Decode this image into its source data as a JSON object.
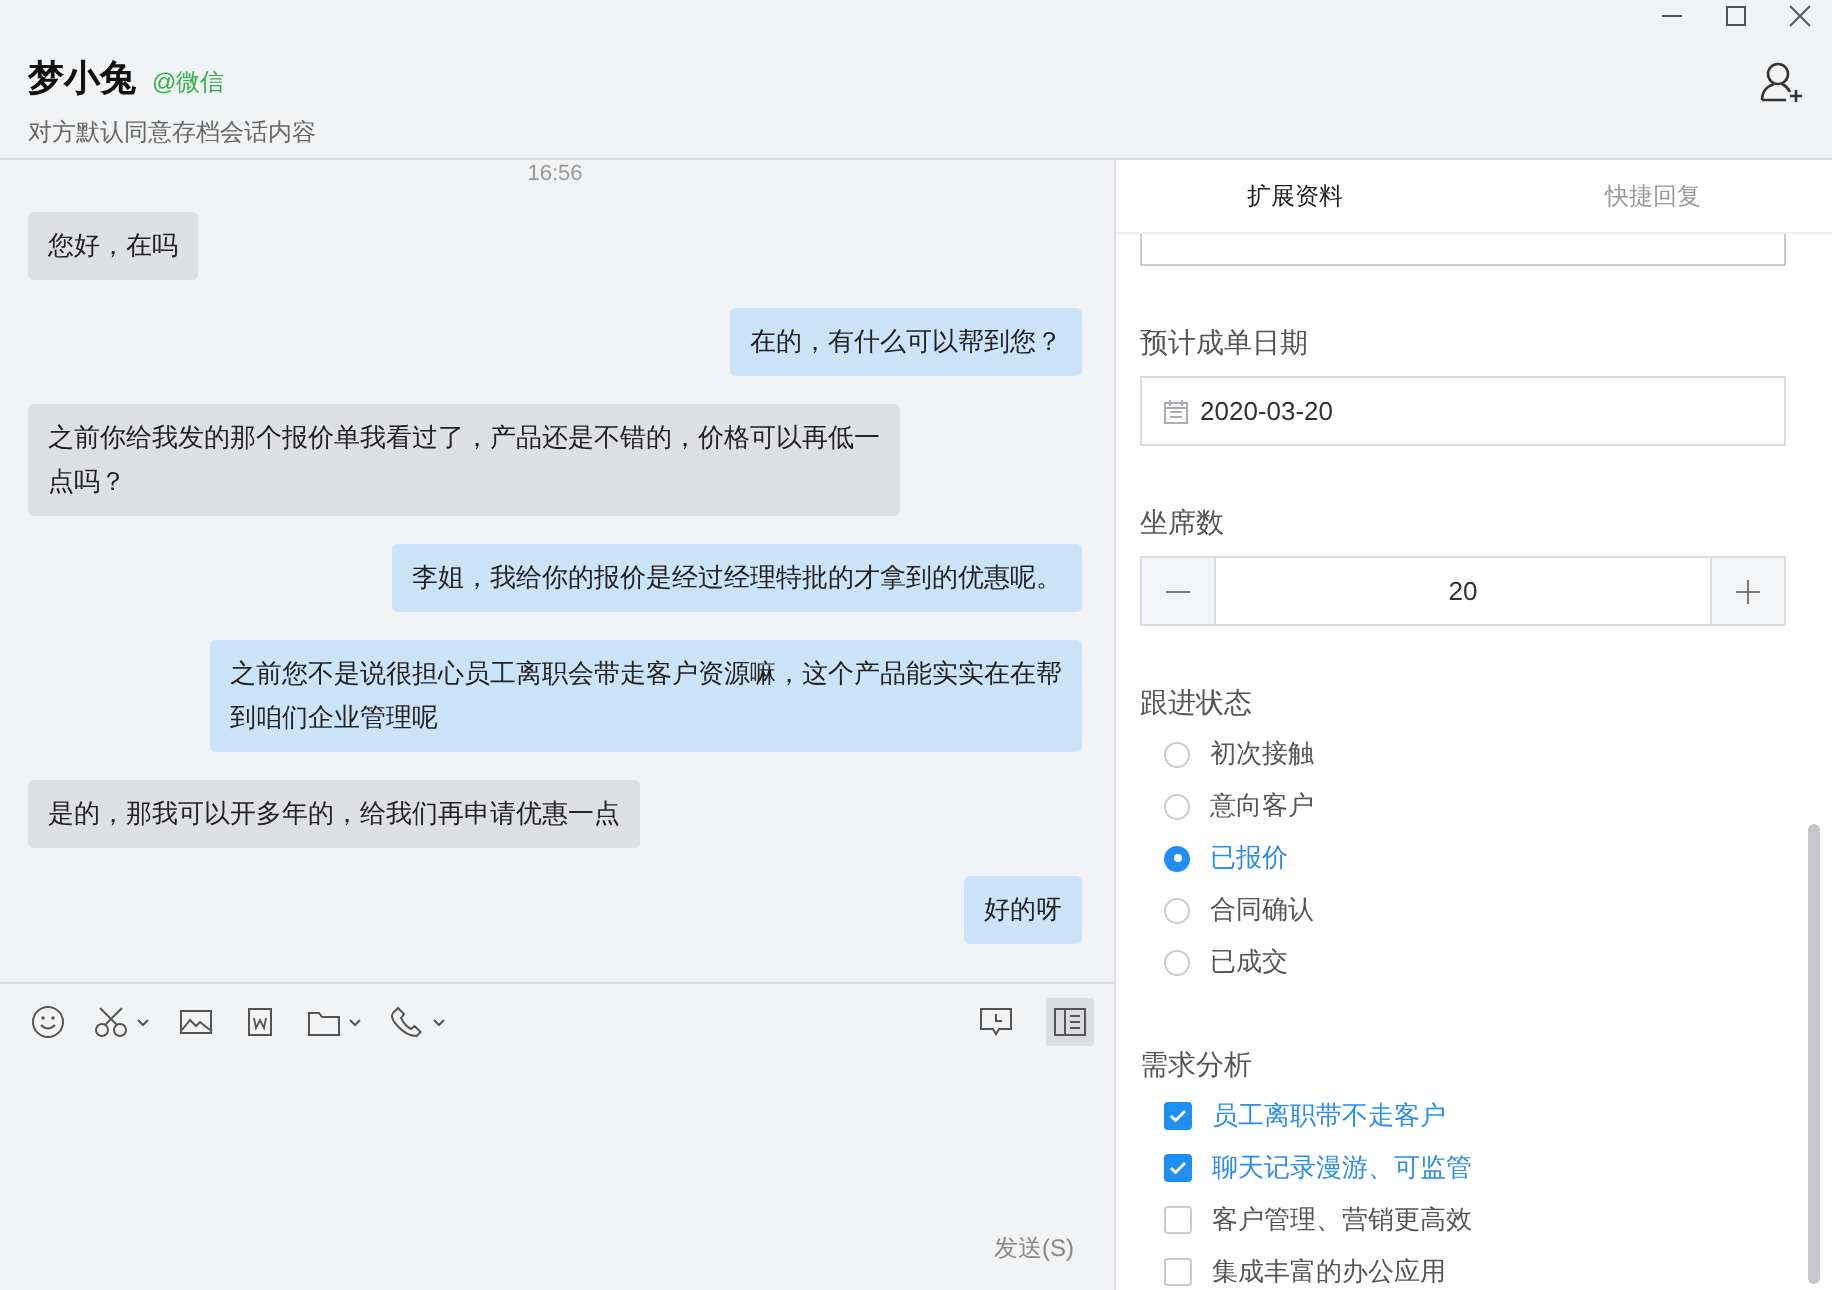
{
  "header": {
    "name": "梦小兔",
    "source": "@微信",
    "subtitle": "对方默认同意存档会话内容"
  },
  "chat": {
    "timestamp": "16:56",
    "messages": [
      {
        "kind": "incoming",
        "text": "您好，在吗"
      },
      {
        "kind": "outgoing",
        "text": "在的，有什么可以帮到您？"
      },
      {
        "kind": "incoming",
        "text": "之前你给我发的那个报价单我看过了，产品还是不错的，价格可以再低一点吗？"
      },
      {
        "kind": "outgoing",
        "text": "李姐，我给你的报价是经过经理特批的才拿到的优惠呢。"
      },
      {
        "kind": "outgoing",
        "text": "之前您不是说很担心员工离职会带走客户资源嘛，这个产品能实实在在帮到咱们企业管理呢"
      },
      {
        "kind": "incoming",
        "text": "是的，那我可以开多年的，给我们再申请优惠一点"
      },
      {
        "kind": "outgoing",
        "text": "好的呀"
      }
    ]
  },
  "composer": {
    "sidebar_toggle": {
      "selected": true
    },
    "send_button": "发送(S)"
  },
  "panel": {
    "tabs": [
      {
        "label": "扩展资料",
        "selected": true
      },
      {
        "label": "快捷回复",
        "selected": false
      }
    ],
    "close_date": {
      "label": "预计成单日期",
      "value": "2020-03-20"
    },
    "seats": {
      "label": "坐席数",
      "value": "20"
    },
    "follow_status": {
      "label": "跟进状态",
      "options": [
        {
          "label": "初次接触",
          "selected": false
        },
        {
          "label": "意向客户",
          "selected": false
        },
        {
          "label": "已报价",
          "selected": true
        },
        {
          "label": "合同确认",
          "selected": false
        },
        {
          "label": "已成交",
          "selected": false
        }
      ]
    },
    "needs": {
      "label": "需求分析",
      "options": [
        {
          "label": "员工离职带不走客户",
          "checked": true
        },
        {
          "label": "聊天记录漫游、可监管",
          "checked": true
        },
        {
          "label": "客户管理、营销更高效",
          "checked": false
        },
        {
          "label": "集成丰富的办公应用",
          "checked": false
        }
      ]
    }
  }
}
